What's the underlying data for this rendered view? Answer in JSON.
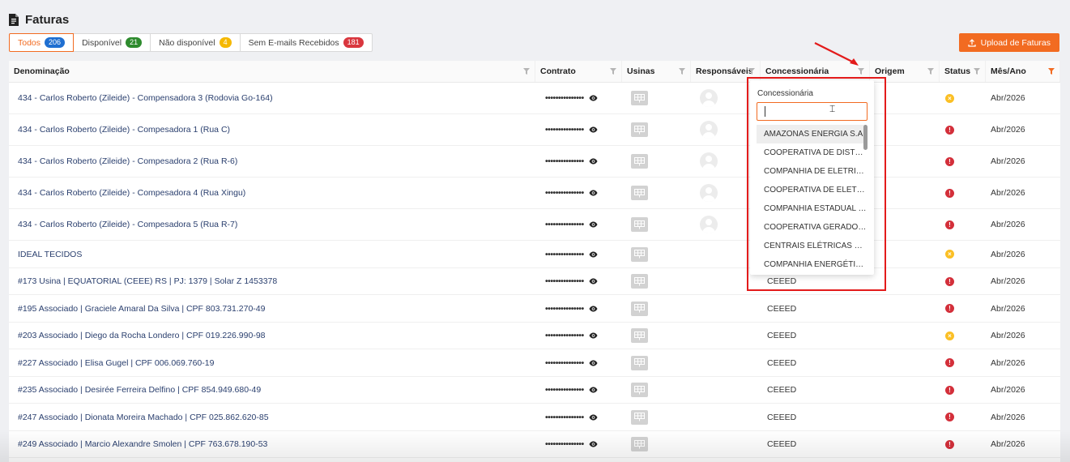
{
  "page": {
    "title": "Faturas"
  },
  "tabs": [
    {
      "label": "Todos",
      "count": "206",
      "color": "#1f6fd1"
    },
    {
      "label": "Disponível",
      "count": "21",
      "color": "#2e8b2e"
    },
    {
      "label": "Não disponível",
      "count": "4",
      "color": "#f5b800"
    },
    {
      "label": "Sem E-mails Recebidos",
      "count": "181",
      "color": "#d9363e"
    }
  ],
  "upload_button": {
    "label": "Upload de Faturas"
  },
  "columns": [
    "Denominação",
    "Contrato",
    "Usinas",
    "Responsáveis",
    "Concessionária",
    "Origem",
    "Status",
    "Mês/Ano"
  ],
  "rows": [
    {
      "name": "434 - Carlos Roberto (Zileide) - Compensadora 3 (Rodovia Go-164)",
      "contract": "•••••••••••••••",
      "concessionaria": "",
      "status": "warning",
      "month": "Abr/2026",
      "avatar": true
    },
    {
      "name": "434 - Carlos Roberto (Zileide) - Compesadora 1 (Rua C)",
      "contract": "•••••••••••••••",
      "concessionaria": "",
      "status": "error",
      "month": "Abr/2026",
      "avatar": true
    },
    {
      "name": "434 - Carlos Roberto (Zileide) - Compesadora 2 (Rua R-6)",
      "contract": "•••••••••••••••",
      "concessionaria": "",
      "status": "error",
      "month": "Abr/2026",
      "avatar": true
    },
    {
      "name": "434 - Carlos Roberto (Zileide) - Compesadora 4 (Rua Xingu)",
      "contract": "•••••••••••••••",
      "concessionaria": "",
      "status": "error",
      "month": "Abr/2026",
      "avatar": true
    },
    {
      "name": "434 - Carlos Roberto (Zileide) - Compesadora 5 (Rua R-7)",
      "contract": "•••••••••••••••",
      "concessionaria": "",
      "status": "error",
      "month": "Abr/2026",
      "avatar": true
    },
    {
      "name": "IDEAL TECIDOS",
      "contract": "•••••••••••••••",
      "concessionaria": "",
      "status": "warning",
      "month": "Abr/2026",
      "avatar": false
    },
    {
      "name": "#173 Usina | EQUATORIAL (CEEE) RS | PJ: 1379 | Solar Z 1453378",
      "contract": "•••••••••••••••",
      "concessionaria": "CEEED",
      "status": "error",
      "month": "Abr/2026",
      "avatar": false
    },
    {
      "name": "#195 Associado | Graciele Amaral Da Silva | CPF 803.731.270-49",
      "contract": "•••••••••••••••",
      "concessionaria": "CEEED",
      "status": "error",
      "month": "Abr/2026",
      "avatar": false
    },
    {
      "name": "#203 Associado | Diego da Rocha Londero | CPF 019.226.990-98",
      "contract": "•••••••••••••••",
      "concessionaria": "CEEED",
      "status": "warning",
      "month": "Abr/2026",
      "avatar": false
    },
    {
      "name": "#227 Associado | Elisa Gugel | CPF 006.069.760-19",
      "contract": "•••••••••••••••",
      "concessionaria": "CEEED",
      "status": "error",
      "month": "Abr/2026",
      "avatar": false
    },
    {
      "name": "#235 Associado | Desirée Ferreira Delfino | CPF 854.949.680-49",
      "contract": "•••••••••••••••",
      "concessionaria": "CEEED",
      "status": "error",
      "month": "Abr/2026",
      "avatar": false
    },
    {
      "name": "#247 Associado | Dionata Moreira Machado | CPF 025.862.620-85",
      "contract": "•••••••••••••••",
      "concessionaria": "CEEED",
      "status": "error",
      "month": "Abr/2026",
      "avatar": false
    },
    {
      "name": "#249 Associado | Marcio Alexandre Smolen | CPF 763.678.190-53",
      "contract": "•••••••••••••••",
      "concessionaria": "CEEED",
      "status": "error",
      "month": "Abr/2026",
      "avatar": false
    }
  ],
  "filter_dropdown": {
    "label": "Concessionária",
    "search_value": "",
    "options": [
      "AMAZONAS ENERGIA S.A",
      "COOPERATIVA DE DISTRIBUIÇÃO",
      "COMPANHIA DE ELETRICIDADE",
      "COOPERATIVA DE ELETRIFICAÇÃO",
      "COMPANHIA ESTADUAL DE ENERGIA",
      "COOPERATIVA GERADORA DE ENERGIA",
      "CENTRAIS ELÉTRICAS DE SANTA CATARINA",
      "COMPANHIA ENERGÉTICA"
    ]
  },
  "colors": {
    "accent": "#f26b21",
    "highlight": "#e31b1b",
    "error": "#d32f3a",
    "warning": "#fbbf24"
  }
}
